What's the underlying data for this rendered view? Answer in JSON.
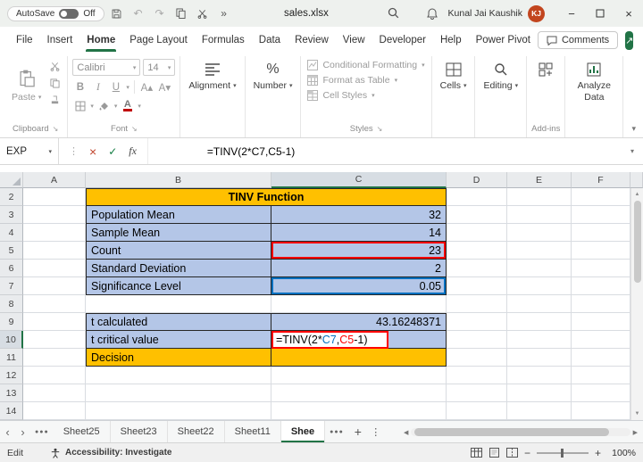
{
  "title_bar": {
    "autosave_label": "AutoSave",
    "autosave_state": "Off",
    "doc_title": "sales.xlsx",
    "user_name": "Kunal Jai Kaushik",
    "user_initials": "KJ"
  },
  "menu_bar": {
    "items": [
      "File",
      "Insert",
      "Home",
      "Page Layout",
      "Formulas",
      "Data",
      "Review",
      "View",
      "Developer",
      "Help",
      "Power Pivot"
    ],
    "active_item": "Home",
    "comments_label": "Comments"
  },
  "ribbon": {
    "paste_label": "Paste",
    "clipboard_group": "Clipboard",
    "font_name": "Calibri",
    "font_size": "14",
    "bold": "B",
    "italic": "I",
    "underline": "U",
    "font_group": "Font",
    "alignment_label": "Alignment",
    "number_label": "Number",
    "number_icon": "%",
    "conditional_formatting": "Conditional Formatting",
    "format_as_table": "Format as Table",
    "cell_styles": "Cell Styles",
    "styles_group": "Styles",
    "cells_label": "Cells",
    "editing_label": "Editing",
    "addins_label": "Add-ins",
    "analyze_label": "Analyze Data"
  },
  "formula_bar": {
    "name_box": "EXP",
    "formula": "=TINV(2*C7,C5-1)",
    "fx_label": "fx"
  },
  "sheet": {
    "col_headers": [
      "A",
      "B",
      "C",
      "D",
      "E",
      "F"
    ],
    "row_headers": [
      "2",
      "3",
      "4",
      "5",
      "6",
      "7",
      "8",
      "9",
      "10",
      "11",
      "12",
      "13",
      "14"
    ],
    "cells": {
      "B2": "TINV Function",
      "B3": "Population Mean",
      "C3": "32",
      "B4": "Sample Mean",
      "C4": "14",
      "B5": "Count",
      "C5": "23",
      "B6": "Standard Deviation",
      "C6": "2",
      "B7": "Significance Level",
      "C7": "0.05",
      "B9": "t calculated",
      "C9": "43.16248371",
      "B10": "t critical value",
      "B11": "Decision"
    },
    "edit_formula": {
      "p1": "=TINV(2*",
      "ref1": "C7",
      "sep": ",",
      "ref2": "C5",
      "p3": "-1)"
    },
    "colors": {
      "header_fill": "#FFC000",
      "data_fill": "#B4C6E7",
      "ref1_color": "#0070C0",
      "ref2_color": "#FF0000",
      "accent_green": "#217346"
    }
  },
  "tab_bar": {
    "tabs": [
      "Sheet25",
      "Sheet23",
      "Sheet22",
      "Sheet11"
    ],
    "active_tab": "Shee"
  },
  "status_bar": {
    "mode": "Edit",
    "accessibility": "Accessibility: Investigate",
    "zoom_level": "100%"
  }
}
